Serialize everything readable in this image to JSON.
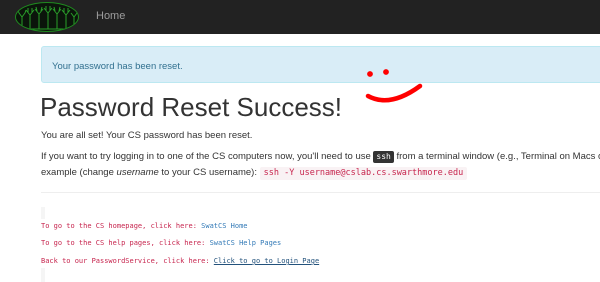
{
  "navbar": {
    "home_label": "Home"
  },
  "alert": {
    "message": "Your password has been reset."
  },
  "main": {
    "title": "Password Reset Success!",
    "intro": "You are all set! Your CS password has been reset.",
    "instructions": {
      "before_kbd": "If you want to try logging in to one of the CS computers now, you'll need to use ",
      "kbd": "ssh",
      "after_kbd": " from a terminal window (e.g., Terminal on Macs or",
      "line2_before": "example (change ",
      "username_word": "username",
      "line2_after": " to your CS username): ",
      "command": "ssh -Y username@cslab.cs.swarthmore.edu"
    }
  },
  "links": [
    {
      "prefix": "To go to the CS homepage, click here: ",
      "link": "SwatCS Home"
    },
    {
      "prefix": "To go to the CS help pages, click here: ",
      "link": "SwatCS Help Pages"
    },
    {
      "prefix": "Back to our PasswordService, click here: ",
      "link": "Click to go to Login Page"
    }
  ],
  "colors": {
    "navbar_bg": "#222222",
    "alert_bg": "#d9edf7",
    "alert_text": "#31708f",
    "smiley": "#ff0000",
    "pre_text": "#c7254e",
    "link": "#337ab7"
  }
}
